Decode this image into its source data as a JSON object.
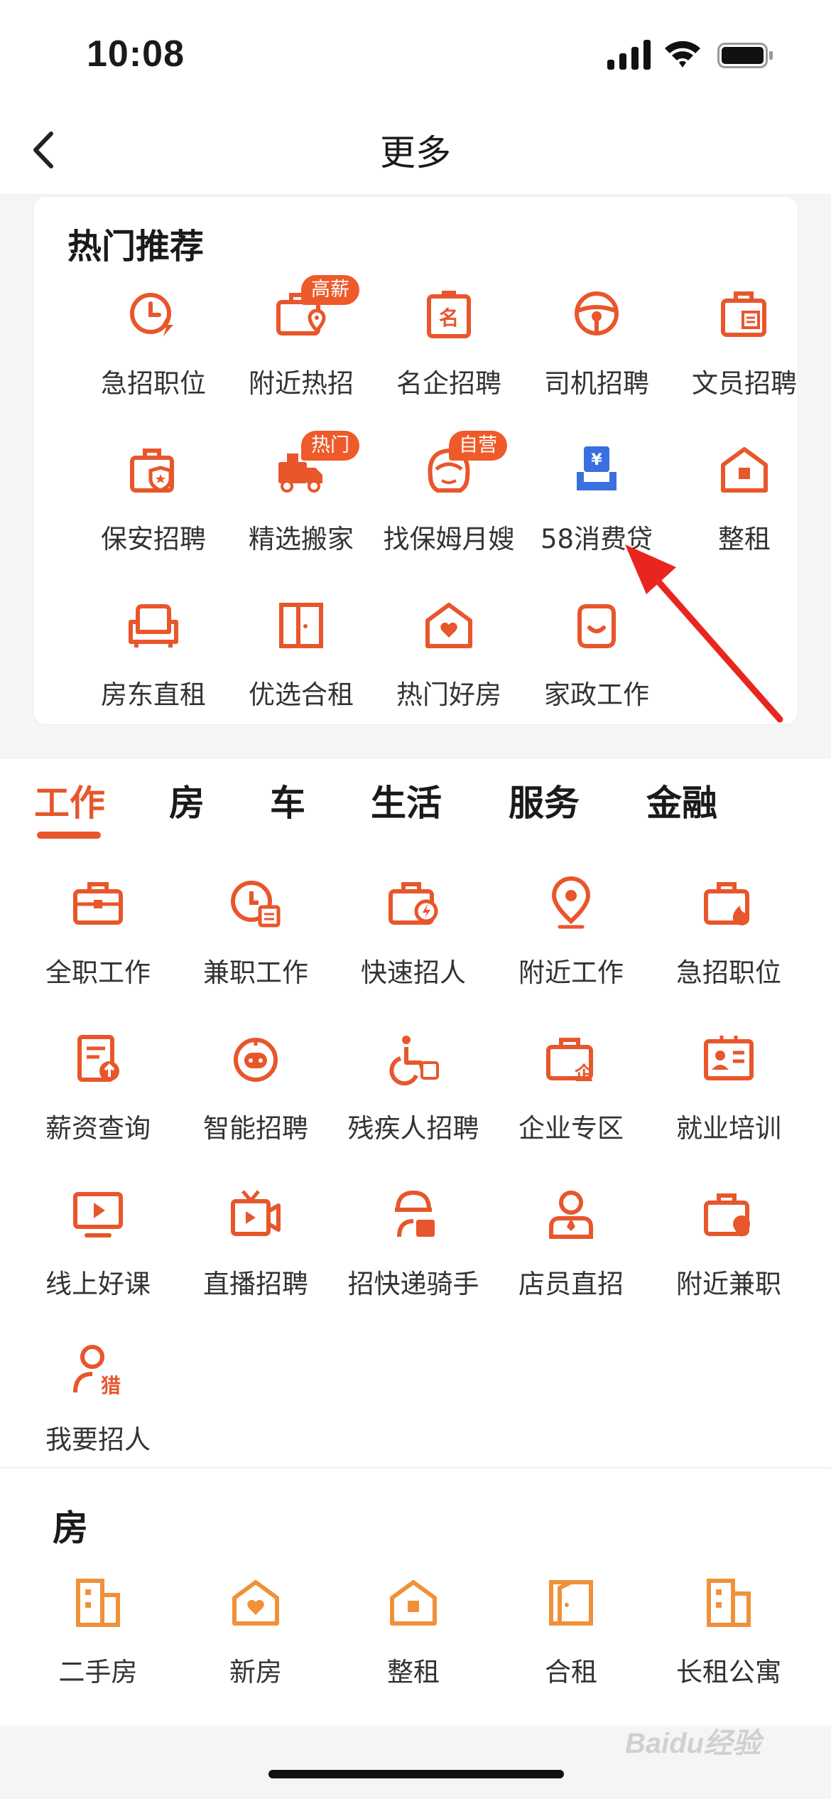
{
  "status_bar": {
    "time": "10:08"
  },
  "nav": {
    "title": "更多"
  },
  "hot": {
    "title": "热门推荐",
    "items": [
      {
        "label": "急招职位",
        "icon": "urgent-clock-icon"
      },
      {
        "label": "附近热招",
        "icon": "nearby-location-icon",
        "badge": "高薪"
      },
      {
        "label": "名企招聘",
        "icon": "famous-company-badge-icon"
      },
      {
        "label": "司机招聘",
        "icon": "steering-wheel-icon"
      },
      {
        "label": "文员招聘",
        "icon": "clerk-briefcase-icon"
      },
      {
        "label": "保安招聘",
        "icon": "security-shield-icon"
      },
      {
        "label": "精选搬家",
        "icon": "moving-truck-icon",
        "badge": "热门"
      },
      {
        "label": "找保姆月嫂",
        "icon": "nanny-face-icon",
        "badge": "自营"
      },
      {
        "label": "58消费贷",
        "icon": "consumer-loan-yen-icon"
      },
      {
        "label": "整租",
        "icon": "whole-rent-house-icon"
      },
      {
        "label": "房东直租",
        "icon": "landlord-sofa-icon"
      },
      {
        "label": "优选合租",
        "icon": "shared-rent-door-icon"
      },
      {
        "label": "热门好房",
        "icon": "hot-house-heart-icon"
      },
      {
        "label": "家政工作",
        "icon": "housekeeping-basket-icon"
      }
    ]
  },
  "tabs": [
    "工作",
    "房",
    "车",
    "生活",
    "服务",
    "金融"
  ],
  "work": {
    "items": [
      {
        "label": "全职工作",
        "icon": "fulltime-briefcase-icon"
      },
      {
        "label": "兼职工作",
        "icon": "parttime-clock-icon"
      },
      {
        "label": "快速招人",
        "icon": "quick-hire-icon"
      },
      {
        "label": "附近工作",
        "icon": "nearby-pin-icon"
      },
      {
        "label": "急招职位",
        "icon": "urgent-fire-icon"
      },
      {
        "label": "薪资查询",
        "icon": "salary-query-icon"
      },
      {
        "label": "智能招聘",
        "icon": "smart-robot-icon"
      },
      {
        "label": "残疾人招聘",
        "icon": "wheelchair-icon"
      },
      {
        "label": "企业专区",
        "icon": "enterprise-icon"
      },
      {
        "label": "就业培训",
        "icon": "training-card-icon"
      },
      {
        "label": "线上好课",
        "icon": "online-course-icon"
      },
      {
        "label": "直播招聘",
        "icon": "live-camera-icon"
      },
      {
        "label": "招快递骑手",
        "icon": "courier-rider-icon"
      },
      {
        "label": "店员直招",
        "icon": "shop-clerk-icon"
      },
      {
        "label": "附近兼职",
        "icon": "nearby-parttime-icon"
      },
      {
        "label": "我要招人",
        "icon": "recruit-headhunter-icon",
        "icon_text": "猎"
      }
    ]
  },
  "house": {
    "title": "房",
    "items": [
      {
        "label": "二手房",
        "icon": "secondhand-building-icon"
      },
      {
        "label": "新房",
        "icon": "new-house-icon"
      },
      {
        "label": "整租",
        "icon": "whole-rent-icon"
      },
      {
        "label": "合租",
        "icon": "shared-rent-icon"
      },
      {
        "label": "长租公寓",
        "icon": "apartment-icon"
      }
    ]
  },
  "watermark": "Baidu经验",
  "colors": {
    "accent": "#e8562b",
    "house_accent": "#f0913a",
    "loan_blue": "#3a6fe0",
    "badge": "#ee5a2a"
  }
}
